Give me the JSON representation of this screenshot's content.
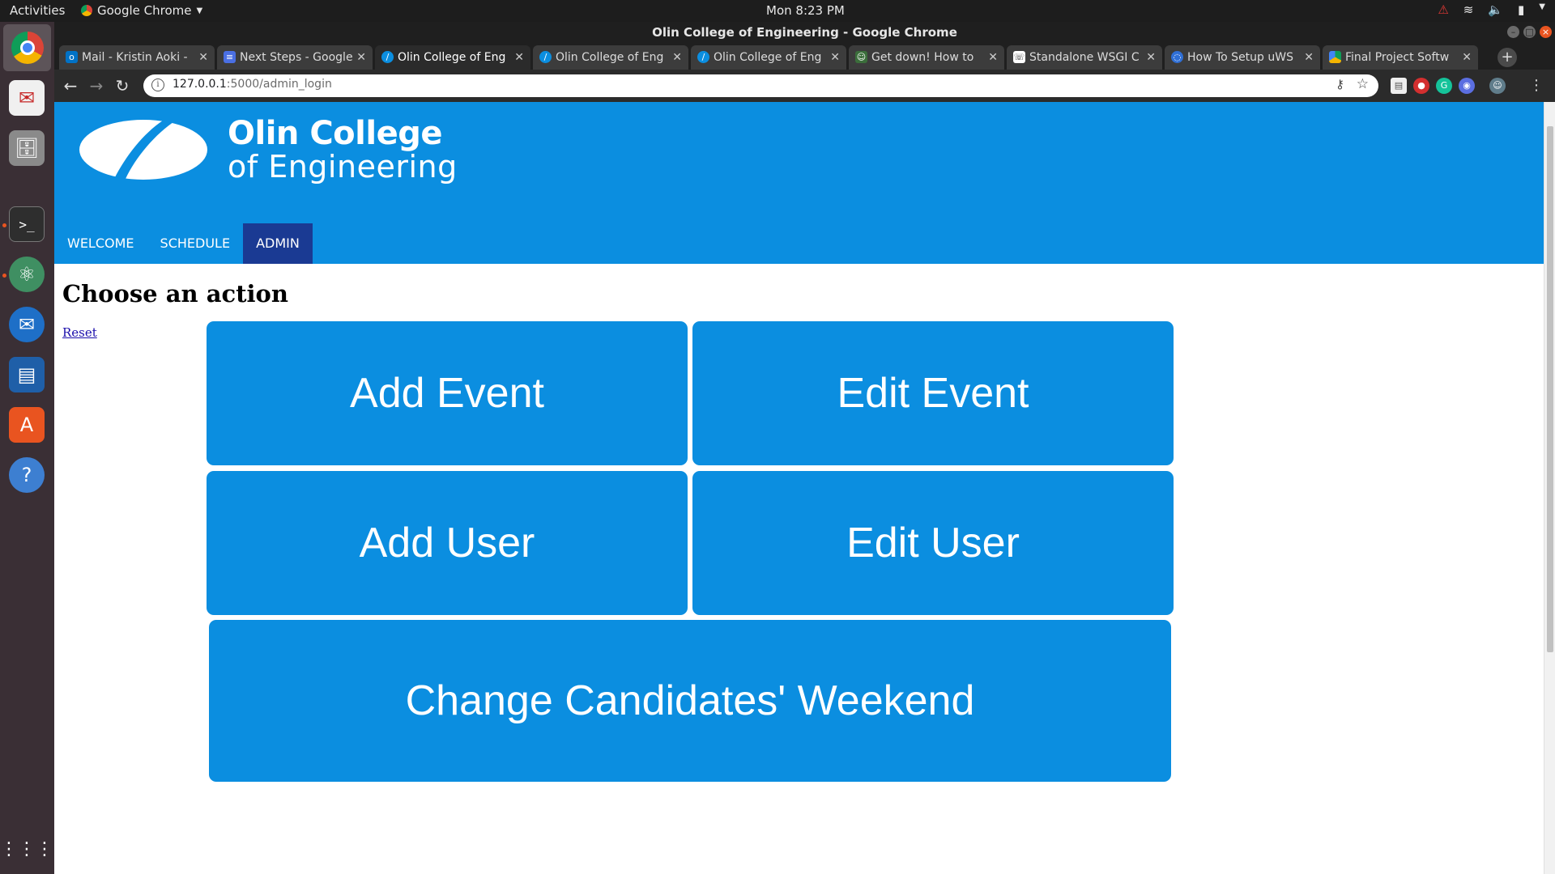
{
  "topbar": {
    "activities": "Activities",
    "app_name": "Google Chrome",
    "clock": "Mon  8:23 PM"
  },
  "window": {
    "title": "Olin College of Engineering - Google Chrome"
  },
  "tabs": [
    {
      "label": "Mail - Kristin Aoki -",
      "icon": "outlook-icon"
    },
    {
      "label": "Next Steps - Google",
      "icon": "docs-icon"
    },
    {
      "label": "Olin College of Eng",
      "icon": "olin-icon",
      "active": true
    },
    {
      "label": "Olin College of Eng",
      "icon": "olin-icon"
    },
    {
      "label": "Olin College of Eng",
      "icon": "olin-icon"
    },
    {
      "label": "Get down! How to",
      "icon": "site-icon"
    },
    {
      "label": "Standalone WSGI C",
      "icon": "site-icon"
    },
    {
      "label": "How To Setup uWS",
      "icon": "site-icon"
    },
    {
      "label": "Final Project Softw",
      "icon": "drive-icon"
    }
  ],
  "address_bar": {
    "host": "127.0.0.1",
    "path": ":5000/admin_login"
  },
  "site": {
    "logo_line1": "Olin College",
    "logo_line2": "of Engineering",
    "nav": [
      "WELCOME",
      "SCHEDULE",
      "ADMIN"
    ],
    "active_nav": "ADMIN"
  },
  "page": {
    "heading": "Choose an action",
    "reset_link": "Reset",
    "actions": {
      "add_event": "Add Event",
      "edit_event": "Edit Event",
      "add_user": "Add User",
      "edit_user": "Edit User",
      "change_weekend": "Change Candidates' Weekend"
    }
  },
  "colors": {
    "brand_blue": "#0b8ee0",
    "nav_active": "#1a3a93",
    "ubuntu_orange": "#e95420"
  }
}
